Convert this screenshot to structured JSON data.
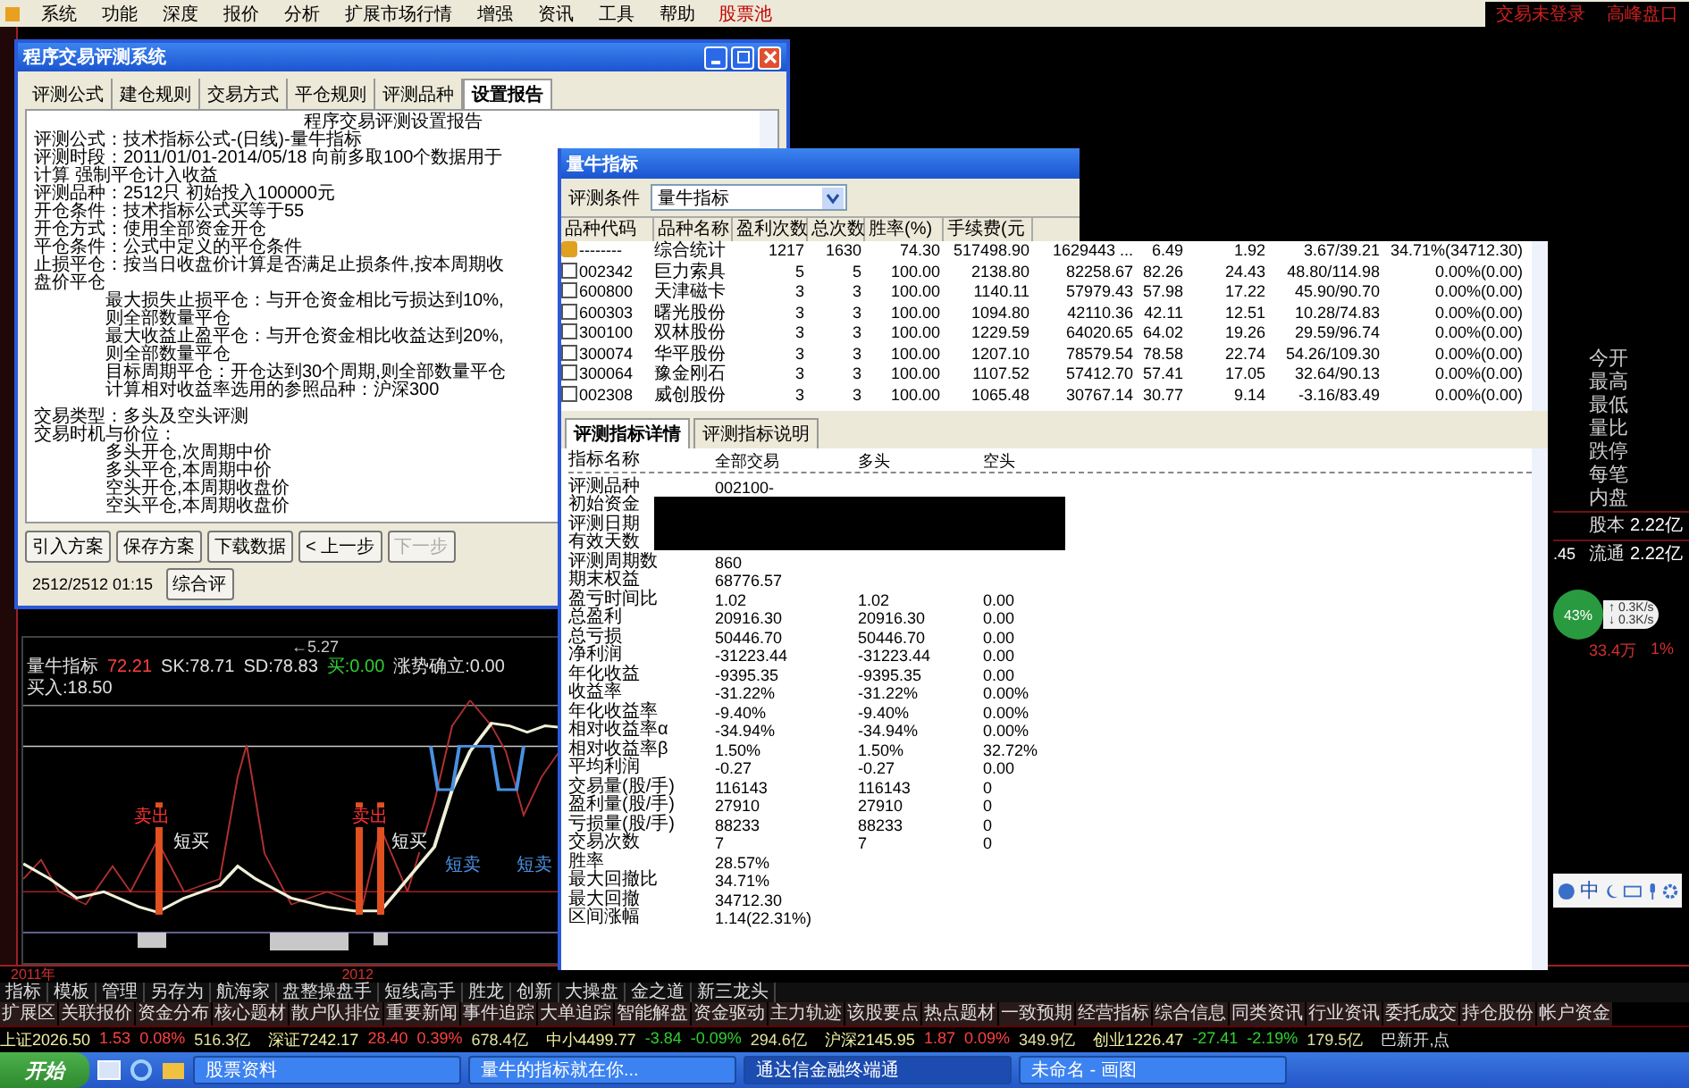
{
  "app_menu": {
    "items": [
      "系统",
      "功能",
      "深度",
      "报价",
      "分析",
      "扩展市场行情",
      "增强",
      "资讯",
      "工具",
      "帮助"
    ],
    "stock_pool": "股票池",
    "status_texts": [
      "交易未登录",
      "高峰盘口"
    ]
  },
  "report_dialog": {
    "title": "程序交易评测系统",
    "tabs": [
      {
        "label": "评测公式",
        "selected": false
      },
      {
        "label": "建仓规则",
        "selected": false
      },
      {
        "label": "交易方式",
        "selected": false
      },
      {
        "label": "平仓规则",
        "selected": false
      },
      {
        "label": "评测品种",
        "selected": false
      },
      {
        "label": "设置报告",
        "selected": true
      }
    ],
    "heading": "程序交易评测设置报告",
    "sections": [
      [
        {
          "text": "评测公式：技术指标公式-(日线)-量牛指标",
          "kind": "main"
        },
        {
          "text": "评测时段：2011/01/01-2014/05/18 向前多取100个数据用于计算 强制平仓计入收益",
          "kind": "main"
        },
        {
          "text": "评测品种：2512只 初始投入100000元",
          "kind": "main"
        },
        {
          "text": "开仓条件：技术指标公式买等于55",
          "kind": "main"
        },
        {
          "text": "开仓方式：使用全部资金开仓",
          "kind": "main"
        },
        {
          "text": "平仓条件：公式中定义的平仓条件",
          "kind": "main"
        },
        {
          "text": "止损平仓：按当日收盘价计算是否满足止损条件,按本周期收盘价平仓",
          "kind": "main"
        },
        {
          "text": "最大损失止损平仓：与开仓资金相比亏损达到10%,则全部数量平仓",
          "kind": "sub"
        },
        {
          "text": "最大收益止盈平仓：与开仓资金相比收益达到20%,则全部数量平仓",
          "kind": "sub"
        },
        {
          "text": "目标周期平仓：开仓达到30个周期,则全部数量平仓",
          "kind": "sub"
        },
        {
          "text": "计算相对收益率选用的参照品种：沪深300",
          "kind": "sub"
        }
      ],
      [
        {
          "text": "交易类型：多头及空头评测",
          "kind": "main"
        },
        {
          "text": "交易时机与价位：",
          "kind": "main"
        },
        {
          "text": "多头开仓,次周期中价",
          "kind": "sub"
        },
        {
          "text": "多头平仓,本周期中价",
          "kind": "sub"
        },
        {
          "text": "空头开仓,本周期收盘价",
          "kind": "sub"
        },
        {
          "text": "空头平仓,本周期收盘价",
          "kind": "sub"
        }
      ]
    ],
    "buttons": [
      {
        "label": "引入方案",
        "disabled": false
      },
      {
        "label": "保存方案",
        "disabled": false
      },
      {
        "label": "下载数据",
        "disabled": false
      },
      {
        "label": "< 上一步",
        "disabled": false
      },
      {
        "label": "下一步",
        "disabled": true
      }
    ],
    "progress_text": "2512/2512 01:15",
    "last_button": "综合评"
  },
  "result_window": {
    "title": "量牛指标",
    "condition": {
      "label": "评测条件",
      "value": "量牛指标"
    },
    "columns": [
      "品种代码",
      "品种名称",
      "盈利次数",
      "总次数",
      "胜率(%)",
      "手续费(元"
    ],
    "rows": [
      {
        "kind": "summary",
        "cells": [
          "--------",
          "综合统计",
          "1217",
          "1630",
          "74.30",
          "517498.90",
          "1629443 ...",
          "6.49",
          "1.92",
          "3.67/39.21",
          "34.71%(34712.30)"
        ]
      },
      {
        "kind": "stock",
        "checked": false,
        "cells": [
          "002342",
          "巨力索具",
          "5",
          "5",
          "100.00",
          "2138.80",
          "82258.67",
          "82.26",
          "24.43",
          "48.80/114.98",
          "0.00%(0.00)"
        ]
      },
      {
        "kind": "stock",
        "checked": false,
        "cells": [
          "600800",
          "天津磁卡",
          "3",
          "3",
          "100.00",
          "1140.11",
          "57979.43",
          "57.98",
          "17.22",
          "45.90/90.70",
          "0.00%(0.00)"
        ]
      },
      {
        "kind": "stock",
        "checked": false,
        "cells": [
          "600303",
          "曙光股份",
          "3",
          "3",
          "100.00",
          "1094.80",
          "42110.36",
          "42.11",
          "12.51",
          "10.28/74.83",
          "0.00%(0.00)"
        ]
      },
      {
        "kind": "stock",
        "checked": false,
        "cells": [
          "300100",
          "双林股份",
          "3",
          "3",
          "100.00",
          "1229.59",
          "64020.65",
          "64.02",
          "19.26",
          "29.59/96.74",
          "0.00%(0.00)"
        ]
      },
      {
        "kind": "stock",
        "checked": false,
        "cells": [
          "300074",
          "华平股份",
          "3",
          "3",
          "100.00",
          "1207.10",
          "78579.54",
          "78.58",
          "22.74",
          "54.26/109.30",
          "0.00%(0.00)"
        ]
      },
      {
        "kind": "stock",
        "checked": false,
        "cells": [
          "300064",
          "豫金刚石",
          "3",
          "3",
          "100.00",
          "1107.52",
          "57412.70",
          "57.41",
          "17.05",
          "32.64/90.13",
          "0.00%(0.00)"
        ]
      },
      {
        "kind": "stock",
        "checked": false,
        "cells": [
          "002308",
          "威创股份",
          "3",
          "3",
          "100.00",
          "1065.48",
          "30767.14",
          "30.77",
          "9.14",
          "-3.16/83.49",
          "0.00%(0.00)"
        ]
      }
    ],
    "sub_tabs": [
      {
        "label": "评测指标详情",
        "selected": true
      },
      {
        "label": "评测指标说明",
        "selected": false
      }
    ],
    "detail_columns": [
      "指标名称",
      "全部交易",
      "多头",
      "空头"
    ],
    "detail_rows": [
      [
        "评测品种",
        "002100-"
      ],
      [
        "初始资金"
      ],
      [
        "评测日期"
      ],
      [
        "有效天数"
      ],
      [
        "评测周期数",
        "860"
      ],
      [
        "期末权益",
        "68776.57"
      ],
      [
        "盈亏时间比",
        "1.02",
        "1.02",
        "0.00"
      ],
      [
        "总盈利",
        "20916.30",
        "20916.30",
        "0.00"
      ],
      [
        "总亏损",
        "50446.70",
        "50446.70",
        "0.00"
      ],
      [
        "净利润",
        "-31223.44",
        "-31223.44",
        "0.00"
      ],
      [
        "年化收益",
        "-9395.35",
        "-9395.35",
        "0.00"
      ],
      [
        "收益率",
        "-31.22%",
        "-31.22%",
        "0.00%"
      ],
      [
        "年化收益率",
        "-9.40%",
        "-9.40%",
        "0.00%"
      ],
      [
        "相对收益率α",
        "-34.94%",
        "-34.94%",
        "0.00%"
      ],
      [
        "相对收益率β",
        "1.50%",
        "1.50%",
        "32.72%"
      ],
      [
        "平均利润",
        "-0.27",
        "-0.27",
        "0.00"
      ],
      [
        "交易量(股/手)",
        "116143",
        "116143",
        "0"
      ],
      [
        "盈利量(股/手)",
        "27910",
        "27910",
        "0"
      ],
      [
        "亏损量(股/手)",
        "88233",
        "88233",
        "0"
      ],
      [
        "交易次数",
        "7",
        "7",
        "0"
      ],
      [
        "胜率",
        "28.57%"
      ],
      [
        "最大回撤比",
        "34.71%"
      ],
      [
        "最大回撤",
        "34712.30"
      ],
      [
        "区间涨幅",
        "1.14(22.31%)"
      ]
    ]
  },
  "chart": {
    "top_note": "←5.27",
    "legend": [
      {
        "text": "量牛指标",
        "color": "#e0e0e0"
      },
      {
        "text": "72.21",
        "color": "#ff4040"
      },
      {
        "text": "SK:78.71",
        "color": "#e0e0e0"
      },
      {
        "text": "SD:78.83",
        "color": "#e0e0e0"
      },
      {
        "text": "买:0.00",
        "color": "#30d030"
      },
      {
        "text": "涨势确立:0.00",
        "color": "#e0e0e0"
      },
      {
        "text": "买入:18.50",
        "color": "#e0e0e0"
      }
    ],
    "signals": [
      {
        "text": "卖出",
        "color": "#ff3030"
      },
      {
        "text": "短买",
        "color": "#f0f0f0"
      },
      {
        "text": "卖出",
        "color": "#ff3030"
      },
      {
        "text": "短买",
        "color": "#f0f0f0"
      },
      {
        "text": "短卖",
        "color": "#4a90e0"
      },
      {
        "text": "短卖",
        "color": "#4a90e0"
      }
    ]
  },
  "quote_panel": {
    "labels": [
      "今开",
      "最高",
      "最低",
      "量比",
      "跌停",
      "每笔",
      "内盘"
    ],
    "share_rows": [
      {
        "prefix": "",
        "label": "股本",
        "value": "2.22亿"
      },
      {
        "prefix": ".45",
        "label": "流通",
        "value": "2.22亿"
      }
    ],
    "gauge": "43%",
    "speeds": [
      "↑ 0.3K/s",
      "↓ 0.3K/s"
    ],
    "inflow": "33.4万",
    "inflow_pct": "1%"
  },
  "ime_bar": {
    "label": "中"
  },
  "time_axis": [
    "2011年",
    "2012"
  ],
  "template_tabs": [
    "指标",
    "模板",
    "管理",
    "另存为",
    "航海家",
    "盘整操盘手",
    "短线高手",
    "胜龙",
    "创新",
    "大操盘",
    "金之道",
    "新三龙头"
  ],
  "extension_tabs": [
    "扩展区",
    "关联报价",
    "资金分布",
    "核心题材",
    "散户队排位",
    "重要新闻",
    "事件追踪",
    "大单追踪",
    "智能解盘",
    "资金驱动",
    "主力轨迹",
    "该股要点",
    "热点题材",
    "一致预期",
    "经营指标",
    "综合信息",
    "同类资讯",
    "行业资讯",
    "委托成交",
    "持仓股份",
    "帐户资金"
  ],
  "indices": [
    {
      "name": "上证",
      "value": "2026.50",
      "change": "1.53",
      "percent": "0.08%",
      "amount": "516.3亿",
      "kind": "up"
    },
    {
      "name": "深证",
      "value": "7242.17",
      "change": "28.40",
      "percent": "0.39%",
      "amount": "678.4亿",
      "kind": "up"
    },
    {
      "name": "中小",
      "value": "4499.77",
      "change": "-3.84",
      "percent": "-0.09%",
      "amount": "294.6亿",
      "kind": "down"
    },
    {
      "name": "沪深",
      "value": "2145.95",
      "change": "1.87",
      "percent": "0.09%",
      "amount": "349.9亿",
      "kind": "up"
    },
    {
      "name": "创业",
      "value": "1226.47",
      "change": "-27.41",
      "percent": "-2.19%",
      "amount": "179.5亿",
      "kind": "down"
    }
  ],
  "status_note": "巴新开,点",
  "taskbar": {
    "start": "开始",
    "items": [
      {
        "label": "股票资料",
        "selected": false
      },
      {
        "label": "量牛的指标就在你...",
        "selected": false
      },
      {
        "label": "通达信金融终端通",
        "selected": true
      },
      {
        "label": "未命名 - 画图",
        "selected": false
      }
    ]
  }
}
